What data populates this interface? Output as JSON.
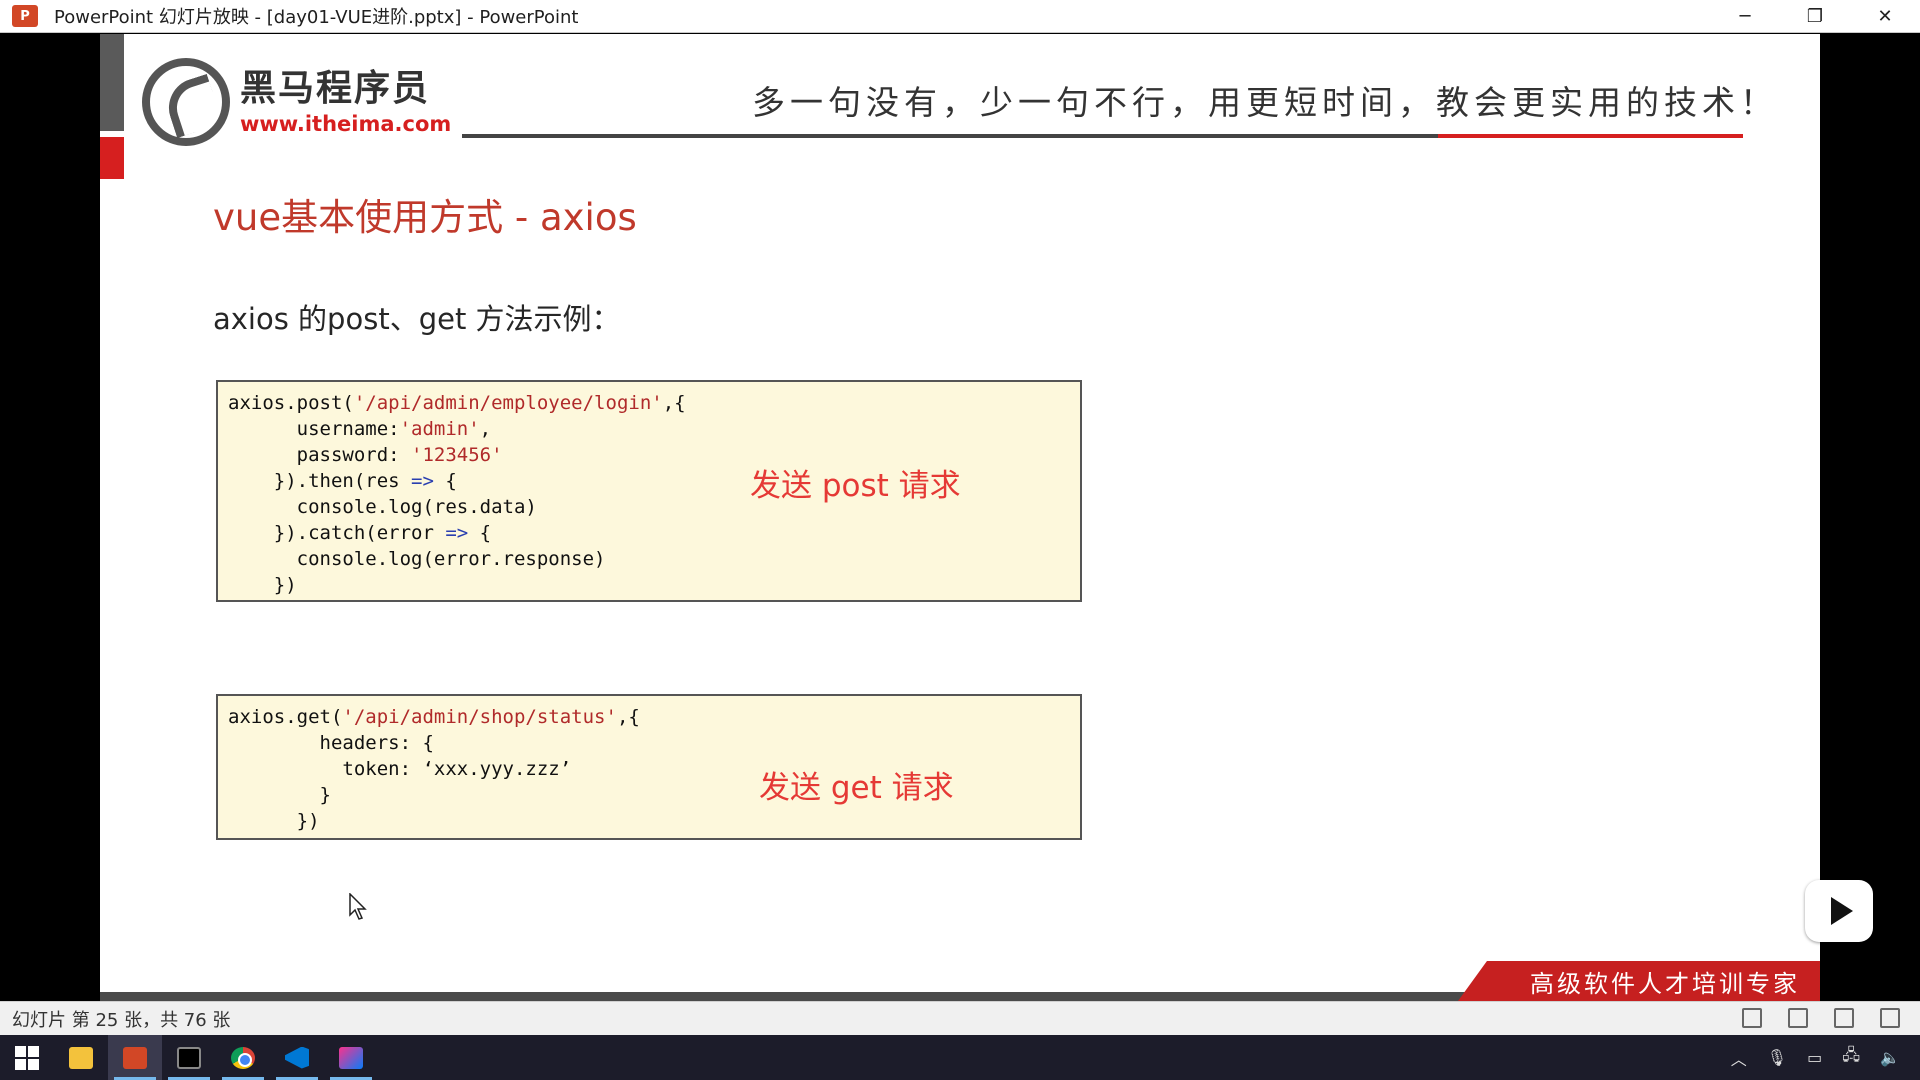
{
  "window": {
    "title": "PowerPoint 幻灯片放映 - [day01-VUE进阶.pptx] - PowerPoint",
    "app_badge": "P",
    "controls": {
      "minimize": "─",
      "restore": "❐",
      "close": "✕"
    }
  },
  "slide": {
    "brand": {
      "name": "黑马程序员",
      "url": "www.itheima.com"
    },
    "slogan": "多一句没有，少一句不行，用更短时间，教会更实用的技术！",
    "title": "vue基本使用方式 - axios",
    "subtitle": "axios  的post、get 方法示例：",
    "post_example": {
      "lines": [
        [
          "axios.post(",
          "'/api/admin/employee/login'",
          ",{"
        ],
        [
          "      username:",
          "'admin'",
          ","
        ],
        [
          "      password: ",
          "'123456'",
          ""
        ],
        [
          "    }).then(res ",
          "=>",
          " {"
        ],
        [
          "      console.log(res.data)",
          "",
          ""
        ],
        [
          "    }).catch(error ",
          "=>",
          " {"
        ],
        [
          "      console.log(error.response)",
          "",
          ""
        ],
        [
          "    })",
          "",
          ""
        ]
      ],
      "note": "发送 post 请求"
    },
    "get_example": {
      "lines": [
        [
          "axios.get(",
          "'/api/admin/shop/status'",
          ",{"
        ],
        [
          "        headers: {",
          "",
          ""
        ],
        [
          "          token: ‘xxx.yyy.zzz’",
          "",
          ""
        ],
        [
          "        }",
          "",
          ""
        ],
        [
          "      })",
          "",
          ""
        ]
      ],
      "note": "发送 get 请求"
    },
    "footer_slogan": "高级软件人才培训专家"
  },
  "statusbar": {
    "slide_count": "幻灯片 第 25 张，共 76 张"
  },
  "taskbar": {
    "apps": [
      "start-icon",
      "file-explorer-icon",
      "powerpoint-icon",
      "terminal-icon",
      "chrome-icon",
      "vscode-icon",
      "intellij-icon"
    ]
  },
  "colors": {
    "title_red": "#c0392b",
    "note_red": "#e53935",
    "code_bg": "#fdf8dc",
    "brand_red": "#d61f1f"
  }
}
